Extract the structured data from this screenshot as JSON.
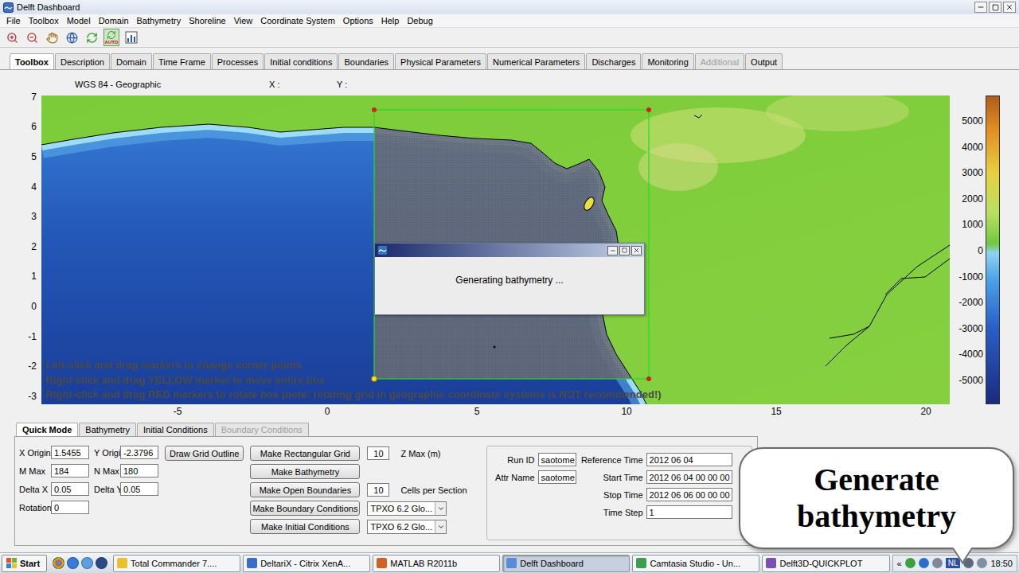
{
  "window": {
    "title": "Delft Dashboard"
  },
  "menu": [
    "File",
    "Toolbox",
    "Model",
    "Domain",
    "Bathymetry",
    "Shoreline",
    "View",
    "Coordinate System",
    "Options",
    "Help",
    "Debug"
  ],
  "toolbar": {
    "auto_label": "AUTO"
  },
  "tabs": [
    {
      "label": "Toolbox",
      "selected": true,
      "disabled": false
    },
    {
      "label": "Description",
      "selected": false,
      "disabled": false
    },
    {
      "label": "Domain",
      "selected": false,
      "disabled": false
    },
    {
      "label": "Time Frame",
      "selected": false,
      "disabled": false
    },
    {
      "label": "Processes",
      "selected": false,
      "disabled": false
    },
    {
      "label": "Initial conditions",
      "selected": false,
      "disabled": false
    },
    {
      "label": "Boundaries",
      "selected": false,
      "disabled": false
    },
    {
      "label": "Physical Parameters",
      "selected": false,
      "disabled": false
    },
    {
      "label": "Numerical Parameters",
      "selected": false,
      "disabled": false
    },
    {
      "label": "Discharges",
      "selected": false,
      "disabled": false
    },
    {
      "label": "Monitoring",
      "selected": false,
      "disabled": false
    },
    {
      "label": "Additional",
      "selected": false,
      "disabled": true
    },
    {
      "label": "Output",
      "selected": false,
      "disabled": false
    }
  ],
  "coordinates": {
    "system": "WGS 84 - Geographic",
    "x_label": "X :",
    "y_label": "Y :"
  },
  "map": {
    "x_ticks": [
      "-5",
      "0",
      "5",
      "10",
      "15",
      "20"
    ],
    "y_ticks": [
      "7",
      "6",
      "5",
      "4",
      "3",
      "2",
      "1",
      "0",
      "-1",
      "-2",
      "-3"
    ],
    "colorbar_ticks": [
      "5000",
      "4000",
      "3000",
      "2000",
      "1000",
      "0",
      "-1000",
      "-2000",
      "-3000",
      "-4000",
      "-5000"
    ],
    "instructions": [
      "Left-click and drag markers to change corner points",
      "Right-click and drag YELLOW marker to move entire box",
      "Right-click and drag RED markers to rotate box (note: rotating grid in geographic coordinate systems is NOT recommended!)"
    ]
  },
  "dialog": {
    "message": "Generating bathymetry ..."
  },
  "quick_mode": {
    "subtabs": [
      {
        "label": "Quick Mode",
        "selected": true,
        "disabled": false
      },
      {
        "label": "Bathymetry",
        "selected": false,
        "disabled": false
      },
      {
        "label": "Initial Conditions",
        "selected": false,
        "disabled": false
      },
      {
        "label": "Boundary Conditions",
        "selected": false,
        "disabled": true
      }
    ],
    "grid_fields": [
      {
        "label": "X Origin",
        "value": "1.5455"
      },
      {
        "label": "Y Origin",
        "value": "-2.3796"
      },
      {
        "label": "M Max",
        "value": "184"
      },
      {
        "label": "N Max",
        "value": "180"
      },
      {
        "label": "Delta X",
        "value": "0.05"
      },
      {
        "label": "Delta Y",
        "value": "0.05"
      },
      {
        "label": "Rotation",
        "value": "0"
      }
    ],
    "outline_button": "Draw Grid Outline",
    "actions": [
      {
        "label": "Make Rectangular Grid",
        "kind": "input",
        "value": "10",
        "unit": "Z Max (m)"
      },
      {
        "label": "Make Bathymetry",
        "kind": "none"
      },
      {
        "label": "Make Open Boundaries",
        "kind": "input",
        "value": "10",
        "unit": "Cells per Section"
      },
      {
        "label": "Make Boundary Conditions",
        "kind": "select",
        "value": "TPXO 6.2 Glo..."
      },
      {
        "label": "Make Initial Conditions",
        "kind": "select",
        "value": "TPXO 6.2 Glo..."
      }
    ],
    "run_fields": [
      {
        "label": "Run ID",
        "value": "saotome"
      },
      {
        "label": "Attr Name",
        "value": "saotome"
      }
    ],
    "time_fields": [
      {
        "label": "Reference Time",
        "value": "2012 06 04"
      },
      {
        "label": "Start Time",
        "value": "2012 06 04 00 00 00"
      },
      {
        "label": "Stop Time",
        "value": "2012 06 06 00 00 00"
      },
      {
        "label": "Time Step",
        "value": "1"
      }
    ]
  },
  "callout": {
    "text": "Generate bathymetry"
  },
  "taskbar": {
    "start": "Start",
    "tasks": [
      {
        "label": "Total Commander 7....",
        "selected": false
      },
      {
        "label": "DeltariX - Citrix XenA...",
        "selected": false
      },
      {
        "label": "MATLAB  R2011b",
        "selected": false
      },
      {
        "label": "Delft Dashboard",
        "selected": true
      },
      {
        "label": "Camtasia Studio - Un...",
        "selected": false
      },
      {
        "label": "Delft3D-QUICKPLOT",
        "selected": false
      }
    ],
    "tray": {
      "expand": "«",
      "language": "NL",
      "time": "18:50"
    }
  }
}
